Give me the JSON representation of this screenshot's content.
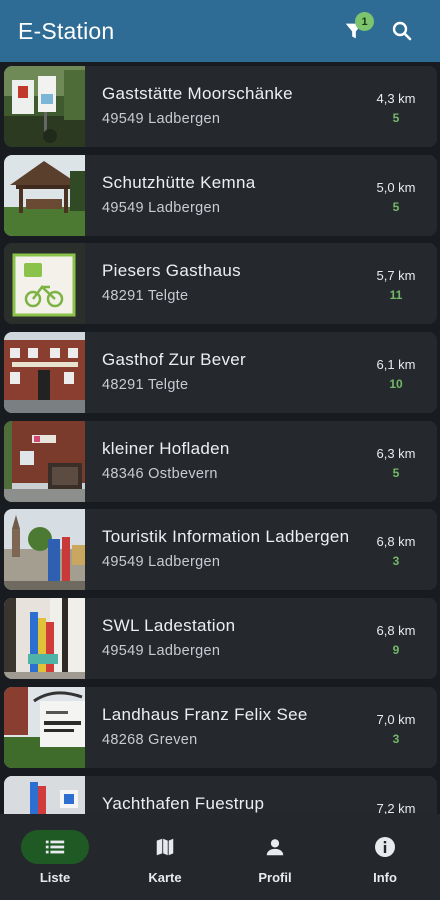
{
  "app": {
    "title": "E-Station",
    "filter_badge": "1"
  },
  "colors": {
    "appbar": "#2e6c95",
    "badge": "#7cc46e",
    "count": "#74b867",
    "active_nav": "#1f5a24"
  },
  "stations": [
    {
      "name": "Gaststätte Moorschänke",
      "address": "49549 Ladbergen",
      "distance": "4,3 km",
      "count": "5",
      "photo": "charging-sign-photo"
    },
    {
      "name": "Schutzhütte Kemna",
      "address": "49549 Ladbergen",
      "distance": "5,0 km",
      "count": "5",
      "photo": "shelter-hut-photo"
    },
    {
      "name": "Piesers Gasthaus",
      "address": "48291 Telgte",
      "distance": "5,7 km",
      "count": "11",
      "photo": "ebike-sign-photo"
    },
    {
      "name": "Gasthof Zur Bever",
      "address": "48291 Telgte",
      "distance": "6,1 km",
      "count": "10",
      "photo": "brick-inn-photo"
    },
    {
      "name": "kleiner Hofladen",
      "address": "48346 Ostbevern",
      "distance": "6,3 km",
      "count": "5",
      "photo": "farm-shop-photo"
    },
    {
      "name": "Touristik Information Ladbergen",
      "address": "49549 Ladbergen",
      "distance": "6,8 km",
      "count": "3",
      "photo": "church-square-photo"
    },
    {
      "name": "SWL Ladestation",
      "address": "49549 Ladbergen",
      "distance": "6,8 km",
      "count": "9",
      "photo": "charging-pillars-photo"
    },
    {
      "name": "Landhaus Franz Felix See",
      "address": "48268 Greven",
      "distance": "7,0 km",
      "count": "3",
      "photo": "hotel-sign-photo"
    },
    {
      "name": "Yachthafen Fuestrup",
      "address": "",
      "distance": "7,2 km",
      "count": "",
      "photo": "harbor-photo"
    }
  ],
  "nav": [
    {
      "label": "Liste",
      "icon": "list-icon",
      "active": true
    },
    {
      "label": "Karte",
      "icon": "map-icon",
      "active": false
    },
    {
      "label": "Profil",
      "icon": "person-icon",
      "active": false
    },
    {
      "label": "Info",
      "icon": "info-icon",
      "active": false
    }
  ]
}
